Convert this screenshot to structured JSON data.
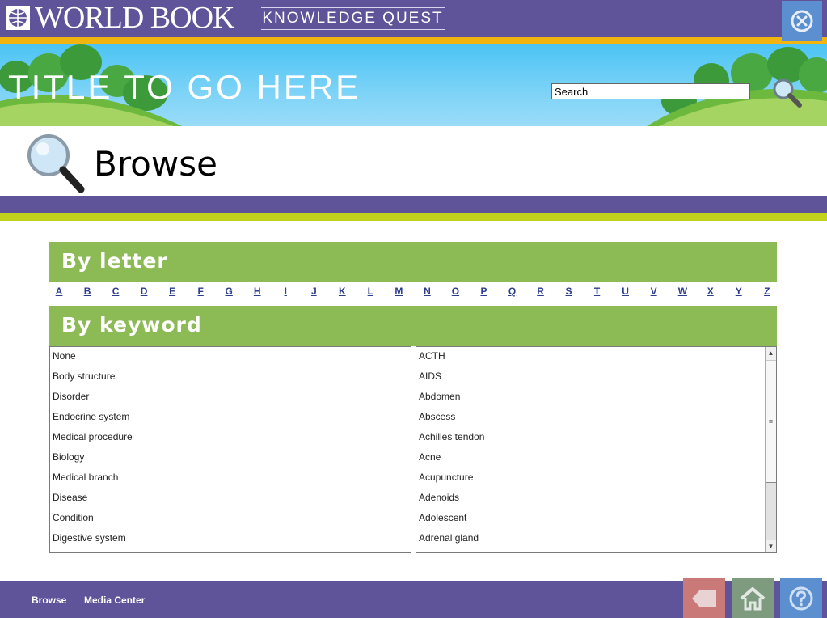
{
  "brand": {
    "logo_text": "WORLD BOOK",
    "product": "KNOWLEDGE QUEST",
    "close_icon": "close-circle-icon"
  },
  "banner": {
    "title": "TITLE TO GO HERE",
    "search_value": "Search",
    "search_icon": "magnifier-icon"
  },
  "page": {
    "title": "Browse",
    "icon": "magnifier-icon"
  },
  "by_letter": {
    "heading": "By letter",
    "letters": [
      "A",
      "B",
      "C",
      "D",
      "E",
      "F",
      "G",
      "H",
      "I",
      "J",
      "K",
      "L",
      "M",
      "N",
      "O",
      "P",
      "Q",
      "R",
      "S",
      "T",
      "U",
      "V",
      "W",
      "X",
      "Y",
      "Z"
    ]
  },
  "by_keyword": {
    "heading": "By keyword",
    "categories": [
      "None",
      "Body structure",
      "Disorder",
      "Endocrine system",
      "Medical procedure",
      "Biology",
      "Medical branch",
      "Disease",
      "Condition",
      "Digestive system"
    ],
    "keywords": [
      "ACTH",
      "AIDS",
      "Abdomen",
      "Abscess",
      "Achilles tendon",
      "Acne",
      "Acupuncture",
      "Adenoids",
      "Adolescent",
      "Adrenal gland"
    ]
  },
  "footer": {
    "links": [
      "Browse",
      "Media Center"
    ],
    "buttons": [
      {
        "icon": "back-arrow-icon",
        "color": "#c97a78"
      },
      {
        "icon": "home-icon",
        "color": "#7e9b80"
      },
      {
        "icon": "help-icon",
        "color": "#5b8fd0"
      }
    ]
  },
  "colors": {
    "purple": "#5f5399",
    "gold": "#f2b50f",
    "green_header": "#8cba55",
    "lime": "#c2d31d",
    "link_blue": "#2a3d8c"
  }
}
